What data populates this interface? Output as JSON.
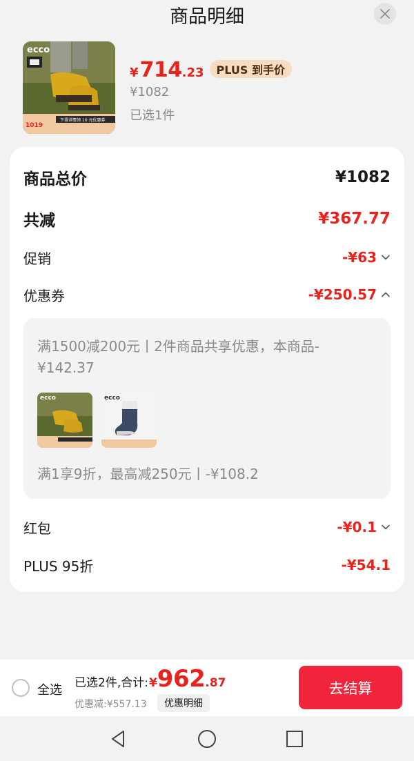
{
  "header": {
    "title": "商品明细"
  },
  "product": {
    "price_symbol": "¥",
    "price_integer": "714",
    "price_decimal": ".23",
    "plus_badge": "PLUS 到手价",
    "original_price": "¥1082",
    "selected_count": "已选1件",
    "image_brand": "ecco",
    "image_promo_price": "1019",
    "image_caption": "下滑详情领 10 元优惠券"
  },
  "breakdown": {
    "total_label": "商品总价",
    "total_value": "¥1082",
    "reduction_label": "共减",
    "reduction_value": "¥367.77",
    "promo_label": "促销",
    "promo_value": "-¥63",
    "coupon_label": "优惠券",
    "coupon_value": "-¥250.57",
    "coupon_detail_1": "满1500减200元丨2件商品共享优惠，本商品-¥142.37",
    "coupon_detail_2": "满1享9折，最高减250元丨-¥108.2",
    "redpacket_label": "红包",
    "redpacket_value": "-¥0.1",
    "plus_label": "PLUS 95折",
    "plus_value": "-¥54.1"
  },
  "coupon_images": [
    {
      "brand": "ecco"
    },
    {
      "brand": "ecco"
    }
  ],
  "bottom_bar": {
    "select_all": "全选",
    "total_prefix": "已选2件,合计:",
    "total_symbol": "¥",
    "total_integer": "962",
    "total_decimal": ".87",
    "savings": "优惠减:¥557.13",
    "details_button": "优惠明细",
    "checkout_button": "去结算"
  },
  "colors": {
    "accent_red": "#e8231c",
    "checkout_red": "#f0243a",
    "plus_badge_bg": "#f7dcc2"
  },
  "navbar": {
    "back": "back-icon",
    "home": "home-icon",
    "recents": "recents-icon"
  }
}
